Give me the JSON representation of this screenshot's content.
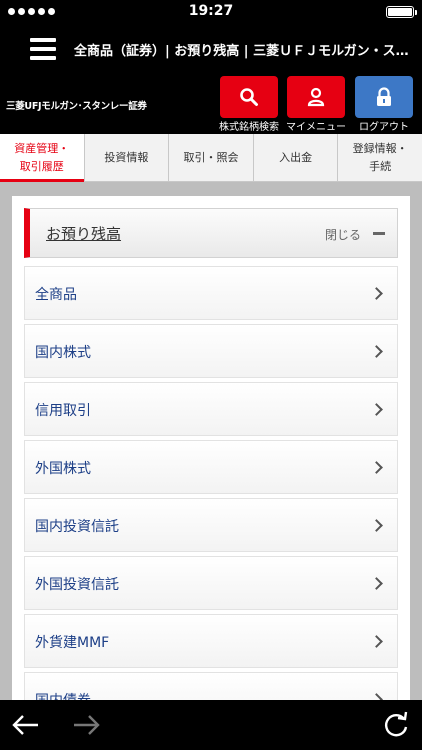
{
  "status_bar": {
    "time": "19:27",
    "signal_dots": 5,
    "battery_level": 1.0
  },
  "header": {
    "title": "全商品（証券）| お預り残高 | 三菱ＵＦＪモルガン・ス…"
  },
  "brand": {
    "logo_text": "三菱UFJモルガン･スタンレー証券",
    "buttons": [
      {
        "label": "株式銘柄検索",
        "icon": "search-icon",
        "color": "#e60012"
      },
      {
        "label": "マイメニュー",
        "icon": "user-icon",
        "color": "#e60012"
      },
      {
        "label": "ログアウト",
        "icon": "lock-icon",
        "color": "#3d78c6"
      }
    ]
  },
  "nav": {
    "tabs": [
      {
        "label": "資産管理・\n取引履歴",
        "active": true
      },
      {
        "label": "投資情報"
      },
      {
        "label": "取引・照会"
      },
      {
        "label": "入出金"
      },
      {
        "label": "登録情報・\n手続"
      }
    ]
  },
  "section": {
    "title": "お預り残高",
    "collapse_label": "閉じる"
  },
  "list": {
    "items": [
      {
        "label": "全商品"
      },
      {
        "label": "国内株式"
      },
      {
        "label": "信用取引"
      },
      {
        "label": "外国株式"
      },
      {
        "label": "国内投資信託"
      },
      {
        "label": "外国投資信託"
      },
      {
        "label": "外貨建MMF"
      },
      {
        "label": "国内債券"
      }
    ]
  },
  "toolbar": {
    "back_icon": "arrow-left-icon",
    "forward_icon": "arrow-right-icon",
    "reload_icon": "reload-icon",
    "forward_enabled": false
  }
}
